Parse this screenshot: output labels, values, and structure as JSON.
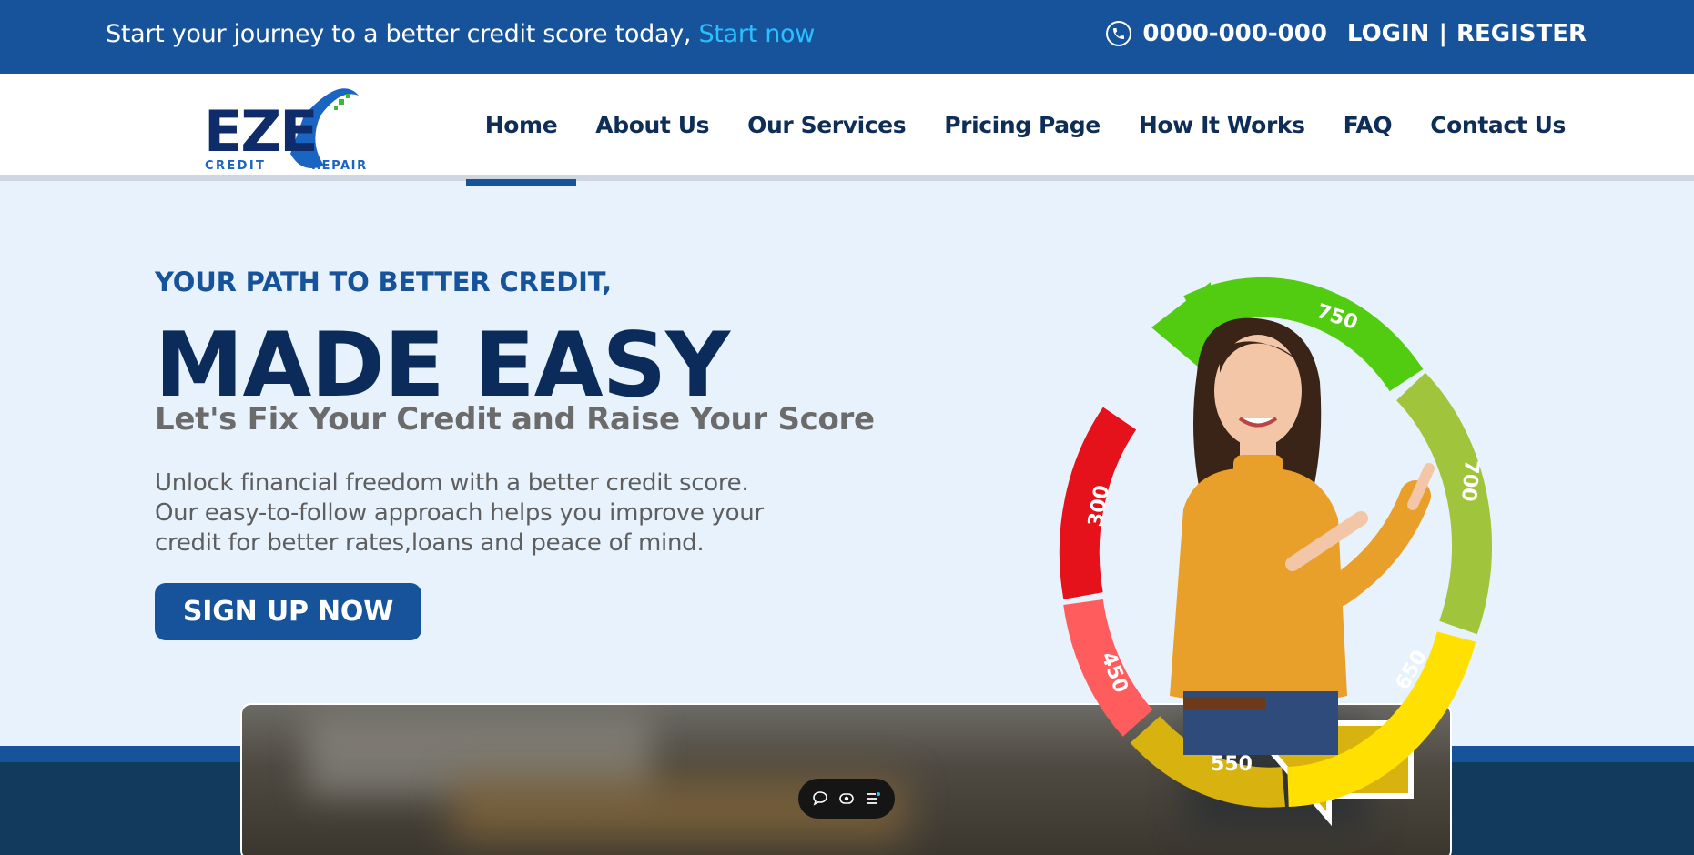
{
  "topbar": {
    "promo_text": "Start your journey to a better credit score today,",
    "promo_link": "Start now",
    "phone": "0000-000-000",
    "login": "LOGIN",
    "separator": "|",
    "register": "REGISTER"
  },
  "brand": {
    "logo_main": "EZE",
    "logo_credit": "CREDIT",
    "logo_repair": "REPAIR"
  },
  "nav": {
    "items": [
      {
        "label": "Home",
        "active": true
      },
      {
        "label": "About Us"
      },
      {
        "label": "Our Services"
      },
      {
        "label": "Pricing Page"
      },
      {
        "label": "How It Works"
      },
      {
        "label": "FAQ"
      },
      {
        "label": "Contact Us"
      }
    ]
  },
  "hero": {
    "kicker": "YOUR PATH TO BETTER CREDIT,",
    "headline": "MADE EASY",
    "subhead": "Let's Fix Your Credit and Raise Your Score",
    "desc_line1": "Unlock financial freedom with a better credit score.",
    "desc_line2": "Our easy-to-follow approach helps you improve your",
    "desc_line3": "credit for better rates,loans and peace of mind.",
    "cta": "SIGN UP NOW"
  },
  "gauge": {
    "labels": [
      "300",
      "450",
      "550",
      "650",
      "700",
      "750"
    ],
    "colors": {
      "red": "#e5121b",
      "salmon": "#ff5d5d",
      "mustard": "#d8b20e",
      "yellow": "#ffe000",
      "lime": "#a0c53d",
      "green": "#52cc10"
    }
  },
  "colors": {
    "brand_blue": "#17539b",
    "navy": "#0b2c5a",
    "link_cyan": "#2ac0ff",
    "hero_bg": "#e8f2fd"
  },
  "floating_toolbar": {
    "icons": [
      "comment-icon",
      "eye-icon",
      "list-icon"
    ]
  }
}
